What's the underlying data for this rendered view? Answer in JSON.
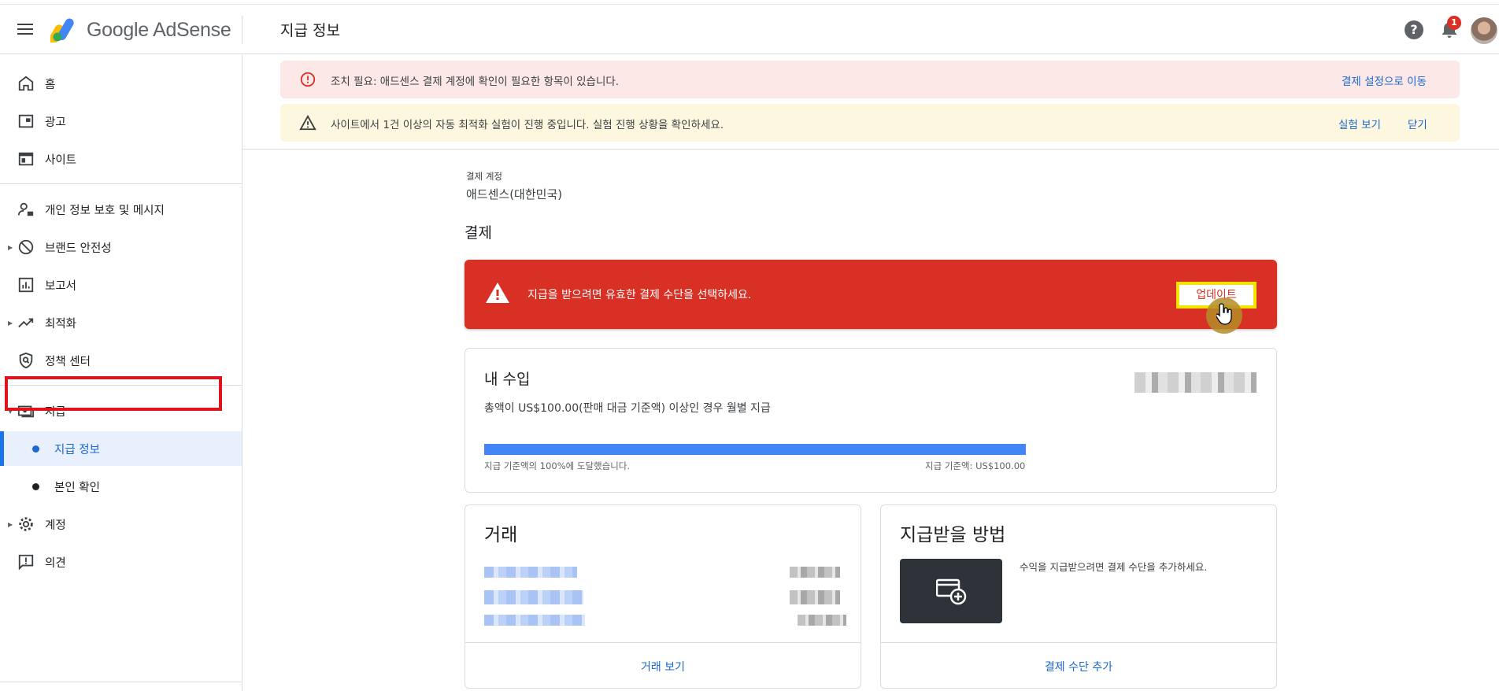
{
  "app": {
    "brand": "Google AdSense",
    "page_title": "지급 정보",
    "notification_count": "1",
    "help_label": "?"
  },
  "sidebar": {
    "items": [
      {
        "label": "홈",
        "icon": "home-icon"
      },
      {
        "label": "광고",
        "icon": "ads-icon"
      },
      {
        "label": "사이트",
        "icon": "sites-icon"
      },
      {
        "label": "개인 정보 보호 및 메시지",
        "icon": "privacy-messaging-icon"
      },
      {
        "label": "브랜드 안전성",
        "icon": "block-icon"
      },
      {
        "label": "보고서",
        "icon": "reports-icon"
      },
      {
        "label": "최적화",
        "icon": "trending-icon"
      },
      {
        "label": "정책 센터",
        "icon": "policy-shield-icon"
      },
      {
        "label": "지급",
        "icon": "payments-icon"
      },
      {
        "label": "지급 정보",
        "icon": "dot"
      },
      {
        "label": "본인 확인",
        "icon": "dot"
      },
      {
        "label": "계정",
        "icon": "gear-icon"
      },
      {
        "label": "의견",
        "icon": "feedback-icon"
      }
    ]
  },
  "banners": {
    "error": {
      "text": "조치 필요: 애드센스 결제 계정에 확인이 필요한 항목이 있습니다.",
      "link": "결제 설정으로 이동"
    },
    "warning": {
      "text": "사이트에서 1건 이상의 자동 최적화 실험이 진행 중입니다. 실험 진행 상황을 확인하세요.",
      "link_view": "실험 보기",
      "link_close": "닫기"
    }
  },
  "account": {
    "label": "결제 계정",
    "name": "애드센스(대한민국)"
  },
  "payments": {
    "section_title": "결제",
    "alert_text": "지급을 받으려면 유효한 결제 수단을 선택하세요.",
    "alert_button": "업데이트"
  },
  "earnings": {
    "title": "내 수입",
    "description": "총액이 US$100.00(판매 대금 기준액) 이상인 경우 월별 지급",
    "progress_percent": 100,
    "progress_left": "지급 기준액의 100%에 도달했습니다.",
    "progress_right": "지급 기준액: US$100.00"
  },
  "transactions": {
    "title": "거래",
    "link": "거래 보기"
  },
  "payment_method": {
    "title": "지급받을 방법",
    "description": "수익을 지급받으려면 결제 수단을 추가하세요.",
    "link": "결제 수단 추가"
  },
  "colors": {
    "accent": "#1a73e8",
    "error": "#d93025",
    "error_bg": "#fce8e6",
    "warning_bg": "#fef7e0",
    "highlight_outline": "#e0141d"
  }
}
